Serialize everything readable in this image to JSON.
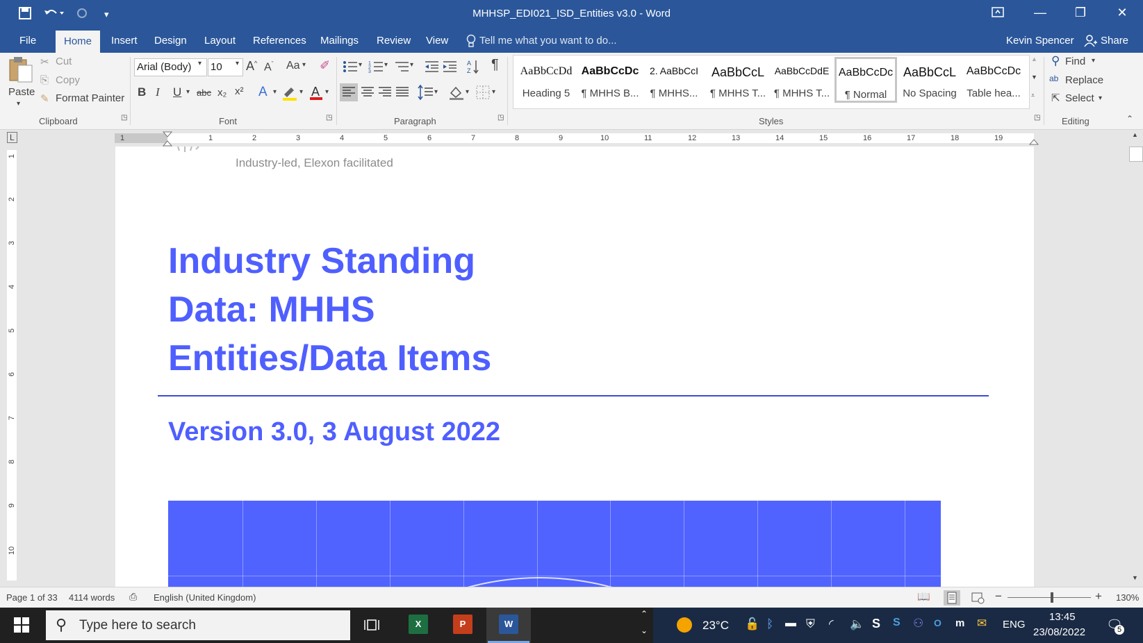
{
  "window": {
    "title": "MHHSP_EDI021_ISD_Entities v3.0 - Word"
  },
  "tabs": [
    "File",
    "Home",
    "Insert",
    "Design",
    "Layout",
    "References",
    "Mailings",
    "Review",
    "View"
  ],
  "active_tab": "Home",
  "tellme_placeholder": "Tell me what you want to do...",
  "user": {
    "name": "Kevin Spencer",
    "share_label": "Share"
  },
  "clipboard": {
    "paste": "Paste",
    "cut": "Cut",
    "copy": "Copy",
    "format_painter": "Format Painter",
    "label": "Clipboard"
  },
  "font": {
    "name": "Arial (Body)",
    "size": "10",
    "label": "Font",
    "case_label": "Aa",
    "bold": "B",
    "italic": "I",
    "underline": "U",
    "strike": "abc",
    "sub": "x₂",
    "sup": "x²"
  },
  "paragraph": {
    "label": "Paragraph"
  },
  "styles": {
    "label": "Styles",
    "items": [
      {
        "sample": "AaBbCcDd",
        "name": "Heading 5"
      },
      {
        "sample": "AaBbCcDc",
        "name": "¶ MHHS B..."
      },
      {
        "sample": "2. AaBbCcI",
        "name": "¶ MHHS..."
      },
      {
        "sample": "AaBbCcL",
        "name": "¶ MHHS T..."
      },
      {
        "sample": "AaBbCcDdE",
        "name": "¶ MHHS T..."
      },
      {
        "sample": "AaBbCcDc",
        "name": "¶ Normal"
      },
      {
        "sample": "AaBbCcL",
        "name": "No Spacing"
      },
      {
        "sample": "AaBbCcDc",
        "name": "Table hea..."
      }
    ],
    "selected_index": 5
  },
  "editing": {
    "label": "Editing",
    "find": "Find",
    "replace": "Replace",
    "select": "Select"
  },
  "ruler": {
    "h_numbers": [
      "1",
      "1",
      "2",
      "3",
      "4",
      "5",
      "6",
      "7",
      "8",
      "9",
      "10",
      "11",
      "12",
      "13",
      "14",
      "15",
      "16",
      "17",
      "18",
      "19"
    ],
    "v_numbers": [
      "1",
      "2",
      "3",
      "4",
      "5",
      "6",
      "7",
      "8",
      "9",
      "10"
    ]
  },
  "document": {
    "tagline": "Industry-led, Elexon facilitated",
    "title_lines": [
      "Industry Standing",
      "Data: MHHS",
      "Entities/Data Items"
    ],
    "version": "Version 3.0, 3 August 2022"
  },
  "status": {
    "page": "Page 1 of 33",
    "words": "4114 words",
    "language": "English (United Kingdom)",
    "zoom": "130%"
  },
  "taskbar": {
    "search_placeholder": "Type here to search",
    "temperature": "23°C",
    "language": "ENG",
    "time": "13:45",
    "date": "23/08/2022",
    "notifications": "5"
  },
  "colors": {
    "word_blue": "#2b579a",
    "title_blue": "#4f5fff",
    "banner_blue": "#5063ff"
  }
}
